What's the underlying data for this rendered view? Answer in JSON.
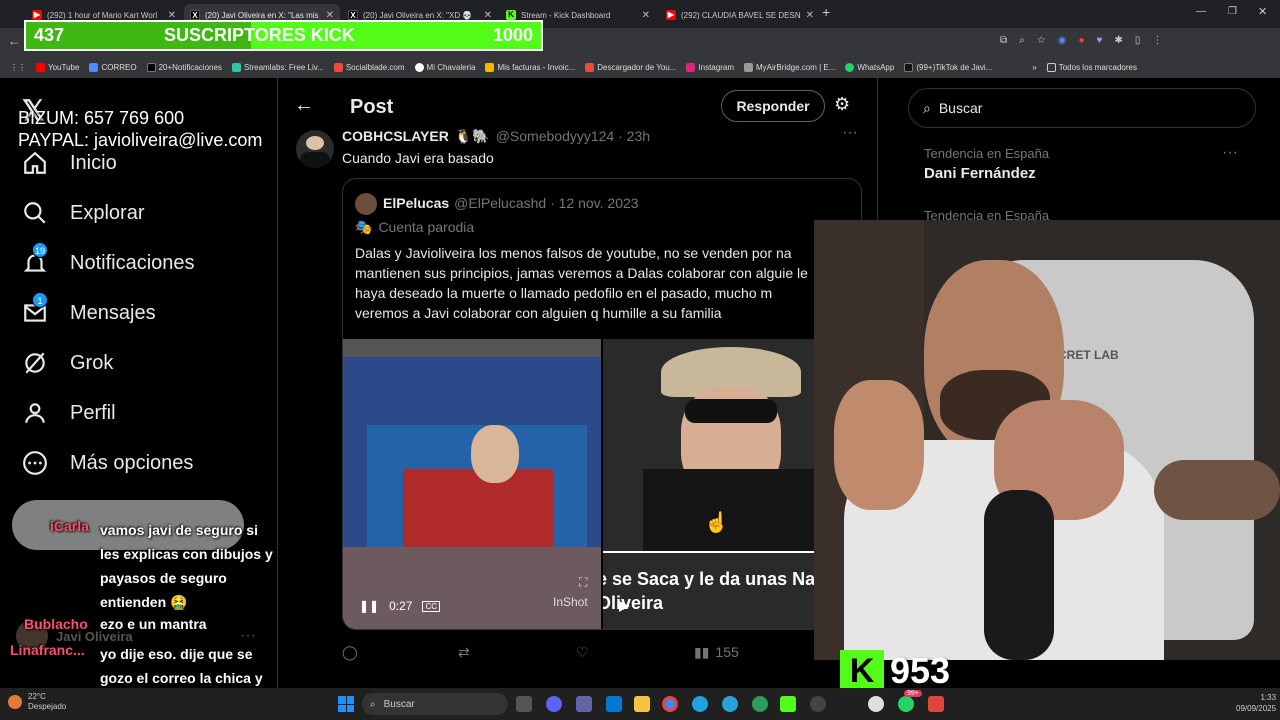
{
  "browser": {
    "tabs": [
      {
        "label": "(292) 1 hour of Mario Kart Worl",
        "fav": "youtube-icon",
        "color": "#ff0000"
      },
      {
        "label": "(20) Javi Oliveira en X: \"Las mis",
        "fav": "x-icon",
        "color": "#000000"
      },
      {
        "label": "(20) Javi Oliveira en X: \"XD 💀",
        "fav": "x-icon",
        "color": "#000000"
      },
      {
        "label": "Stream - Kick Dashboard",
        "fav": "kick-icon",
        "color": "#53fc18"
      },
      {
        "label": "(292) CLAUDIA BAVEL SE DESN",
        "fav": "youtube-icon",
        "color": "#ff0000"
      }
    ],
    "bookmarks": [
      "YouTube",
      "CORREO",
      "20+Notificaciones",
      "Streamlabs: Free Liv...",
      "Socialblade.com",
      "Mi Chavaleria",
      "Mis facturas - Invoic...",
      "Descargador de You...",
      "Instagram",
      "MyAirBridge.com | E...",
      "WhatsApp",
      "(99+)TikTok de Javi...",
      "Todos los marcadores"
    ]
  },
  "overlay": {
    "subs_current": "437",
    "subs_label": "SUSCRIPTORES KICK",
    "subs_goal": "1000",
    "subs_fraction": 0.437,
    "bizum": "BIZUM: 657 769 600",
    "paypal": "PAYPAL: javioliveira@live.com",
    "kick_count": "953"
  },
  "nav": {
    "items": [
      {
        "label": "Inicio",
        "icon": "home-icon"
      },
      {
        "label": "Explorar",
        "icon": "search-icon"
      },
      {
        "label": "Notificaciones",
        "icon": "bell-icon",
        "badge": "19"
      },
      {
        "label": "Mensajes",
        "icon": "mail-icon",
        "badge": "1"
      },
      {
        "label": "Grok",
        "icon": "grok-icon"
      },
      {
        "label": "Perfil",
        "icon": "person-icon"
      },
      {
        "label": "Más opciones",
        "icon": "more-icon"
      }
    ]
  },
  "post": {
    "header_title": "Post",
    "reply_button": "Responder",
    "author_name": "COBHCSLAYER",
    "author_handle": "@Somebodyyy124 · 23h",
    "text": "Cuando Javi era basado",
    "quote": {
      "name": "ElPelucas",
      "handle": "@ElPelucashd · 12 nov. 2023",
      "label": "Cuenta parodia",
      "text": "Dalas y Javioliveira los menos falsos de youtube, no se venden por na mantienen sus principios, jamas veremos a Dalas colaborar con alguie le haya deseado la muerte o llamado pedofilo en el pasado, mucho m veremos a Javi colaborar con alguien q humille a su familia",
      "video_time": "0:27",
      "caption": "e se Saca y le da unas Na Oliveira",
      "watermark": "InShot"
    },
    "views": "155"
  },
  "right": {
    "search_placeholder": "Buscar",
    "trends": [
      {
        "context": "Tendencia en España",
        "title": "Dani Fernández"
      },
      {
        "context": "Tendencia en España",
        "title": ""
      }
    ]
  },
  "chat": [
    {
      "user": "iCarla",
      "color": "#ff4d6d",
      "msg": "vamos javi de seguro si les explicas con dibujos y payasos de seguro entienden 🤮"
    },
    {
      "user": "Bublacho",
      "color": "#ff4d6d",
      "msg": "ezo e un mantra"
    },
    {
      "user": "Linafranc...",
      "color": "#ff4d6d",
      "msg": "yo dije eso. dije que se gozo el correo la chica y bueno"
    }
  ],
  "taskbar": {
    "weather_temp": "22°C",
    "weather_text": "Despejado",
    "search": "Buscar",
    "time": "1:33",
    "date": "09/09/2025",
    "whatsapp_badge": "99+"
  }
}
